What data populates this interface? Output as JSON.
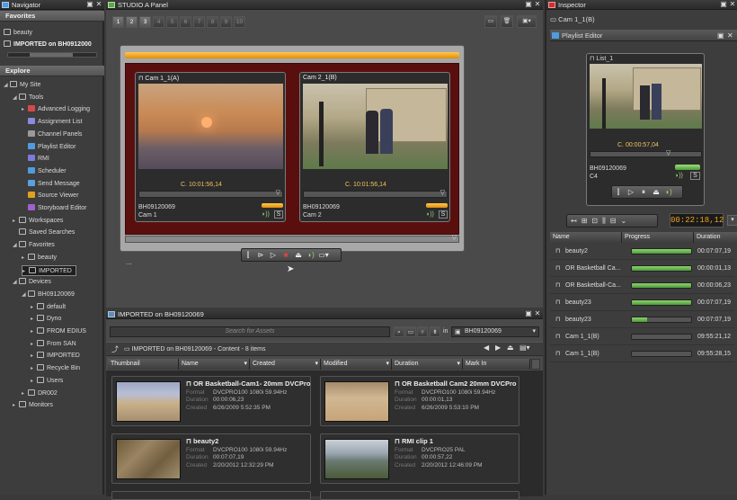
{
  "navigator": {
    "title": "Navigator",
    "favorites_header": "Favorites",
    "favorites": [
      "beauty",
      "IMPORTED on BH0912000"
    ],
    "explore_header": "Explore",
    "tree": [
      {
        "label": "My Site",
        "level": 0,
        "icon": "site-icon"
      },
      {
        "label": "Tools",
        "level": 1,
        "icon": "tools-icon"
      },
      {
        "label": "Advanced Logging",
        "level": 2,
        "icon": "logging-icon"
      },
      {
        "label": "Assignment List",
        "level": 2,
        "icon": "list-icon"
      },
      {
        "label": "Channel Panels",
        "level": 2,
        "icon": "channel-icon"
      },
      {
        "label": "Playlist Editor",
        "level": 2,
        "icon": "playlist-icon"
      },
      {
        "label": "RMI",
        "level": 2,
        "icon": "rmi-icon"
      },
      {
        "label": "Scheduler",
        "level": 2,
        "icon": "scheduler-icon"
      },
      {
        "label": "Send Message",
        "level": 2,
        "icon": "message-icon"
      },
      {
        "label": "Source Viewer",
        "level": 2,
        "icon": "viewer-icon"
      },
      {
        "label": "Storyboard Editor",
        "level": 2,
        "icon": "storyboard-icon"
      },
      {
        "label": "Workspaces",
        "level": 1,
        "icon": "workspaces-icon"
      },
      {
        "label": "Saved Searches",
        "level": 1,
        "icon": "search-icon"
      },
      {
        "label": "Favorites",
        "level": 1,
        "icon": "star-icon"
      },
      {
        "label": "beauty",
        "level": 2,
        "icon": "folder-icon"
      },
      {
        "label": "IMPORTED",
        "level": 2,
        "icon": "folder-icon"
      },
      {
        "label": "Devices",
        "level": 1,
        "icon": "devices-icon"
      },
      {
        "label": "BH09120069",
        "level": 2,
        "icon": "device-icon"
      },
      {
        "label": "default",
        "level": 3,
        "icon": "folder-icon"
      },
      {
        "label": "Dyno",
        "level": 3,
        "icon": "folder-icon"
      },
      {
        "label": "FROM EDIUS",
        "level": 3,
        "icon": "folder-icon"
      },
      {
        "label": "From SAN",
        "level": 3,
        "icon": "folder-icon"
      },
      {
        "label": "IMPORTED",
        "level": 3,
        "icon": "folder-icon"
      },
      {
        "label": "Recycle Bin",
        "level": 3,
        "icon": "recycle-icon"
      },
      {
        "label": "Users",
        "level": 3,
        "icon": "folder-icon"
      },
      {
        "label": "DR002",
        "level": 2,
        "icon": "device-icon"
      },
      {
        "label": "Monitors",
        "level": 1,
        "icon": "monitor-icon"
      }
    ]
  },
  "studio": {
    "title": "STUDIO A Panel",
    "tabs": [
      "1",
      "2",
      "3",
      "4",
      "5",
      "6",
      "7",
      "8",
      "9",
      "10"
    ],
    "viewer1": {
      "title": "Cam 1_1(A)",
      "timecode": "C. 10:01:56,14",
      "clip": "BH09120069",
      "name": "Cam 1",
      "s": "S"
    },
    "viewer2": {
      "title": "Cam 2_1(B)",
      "timecode": "C. 10:01:56,14",
      "clip": "BH09120069",
      "name": "Cam 2",
      "s": "S"
    },
    "dots": "..."
  },
  "assets": {
    "title": "IMPORTED on BH09120069",
    "search_placeholder": "Search for Assets",
    "in_label": "in",
    "location": "BH09120069",
    "path": "IMPORTED on BH09120069",
    "content_label": "- Content -",
    "count": "8 items",
    "columns": [
      "Thumbnail",
      "Name",
      "Created",
      "Modified",
      "Duration",
      "Mark In"
    ],
    "items": [
      {
        "name": "OR Basketball-Cam1- 20mm DVCPro",
        "format": "DVCPRO100 1080i 59.94Hz",
        "duration": "00:00:06,23",
        "created": "6/26/2009 5:52:35 PM"
      },
      {
        "name": "OR Basketball Cam2 20mm DVCPro",
        "format": "DVCPRO100 1080i 59.94Hz",
        "duration": "00:00:01,13",
        "created": "6/26/2009 5:53:10 PM"
      },
      {
        "name": "beauty2",
        "format": "DVCPRO100 1080i 59.94Hz",
        "duration": "00:07:07,19",
        "created": "2/20/2012 12:32:29 PM"
      },
      {
        "name": "RMI clip 1",
        "format": "DVCPRO25 PAL",
        "duration": "00:00:57,22",
        "created": "2/20/2012 12:46:09 PM"
      }
    ],
    "meta_labels": {
      "format": "Format",
      "duration": "Duration",
      "created": "Created"
    }
  },
  "inspector": {
    "title": "Inspector",
    "subject": "Cam 1_1(B)",
    "playlist_title": "Playlist Editor",
    "list_name": "List_1",
    "timecode": "C. 00:00:57,04",
    "clip": "BH09120069",
    "channel": "C4",
    "s": "S",
    "total_time": "00:22:18,12",
    "columns": [
      "Name",
      "Progress",
      "Duration"
    ],
    "rows": [
      {
        "name": "beauty2",
        "progress": 1.0,
        "duration": "00:07:07,19"
      },
      {
        "name": "OR Basketball Ca...",
        "progress": 1.0,
        "duration": "00:00:01,13"
      },
      {
        "name": "OR Basketball-Ca...",
        "progress": 1.0,
        "duration": "00:00:06,23"
      },
      {
        "name": "beauty23",
        "progress": 1.0,
        "duration": "00:07:07,19"
      },
      {
        "name": "beauty23",
        "progress": 0.25,
        "duration": "00:07:07,19"
      },
      {
        "name": "Cam 1_1(B)",
        "progress": 0.0,
        "duration": "09:55:21,12"
      },
      {
        "name": "Cam 1_1(B)",
        "progress": 0.0,
        "duration": "09:55:28,15"
      }
    ]
  },
  "colors": {
    "accent_orange": "#f0a020",
    "progress_green": "#6cc04a",
    "playlist_blue": "#4f9be0"
  }
}
